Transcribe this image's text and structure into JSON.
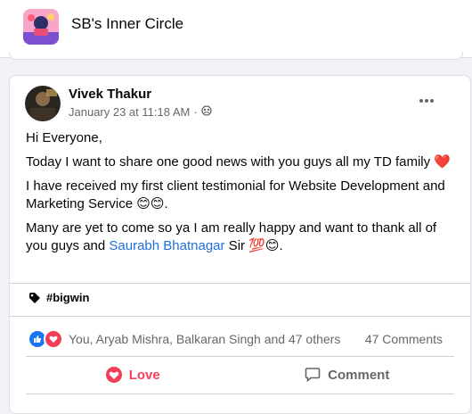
{
  "group": {
    "name": "SB's Inner Circle"
  },
  "post": {
    "author": "Vivek Thakur",
    "timestamp": "January 23 at 11:18 AM",
    "separator": "·",
    "audience_icon": "group-audience-icon",
    "paragraphs": {
      "p1": "Hi Everyone,",
      "p2": "Today I want to share one good news with you guys all my TD family",
      "p2_emoji": "❤️",
      "p3": "I have received my first client testimonial for Website Development and Marketing Service",
      "p3_emoji": "😊😊.",
      "p4_start": "Many are yet to come so ya I am really happy and want to thank all of you guys and",
      "mention": "Saurabh Bhatnagar",
      "p4_end": " Sir ",
      "p4_emoji": "💯😊."
    },
    "hashtag": "#bigwin",
    "reactions": {
      "summary": "You, Aryab Mishra, Balkaran Singh and 47 others",
      "comments": "47 Comments",
      "icons": [
        "like-reaction-icon",
        "love-reaction-icon"
      ]
    },
    "actions": {
      "love": "Love",
      "comment": "Comment"
    }
  },
  "colors": {
    "love": "#f33e58",
    "like": "#1877f2",
    "mention": "#216fdb",
    "secondary_text": "#65676b"
  }
}
